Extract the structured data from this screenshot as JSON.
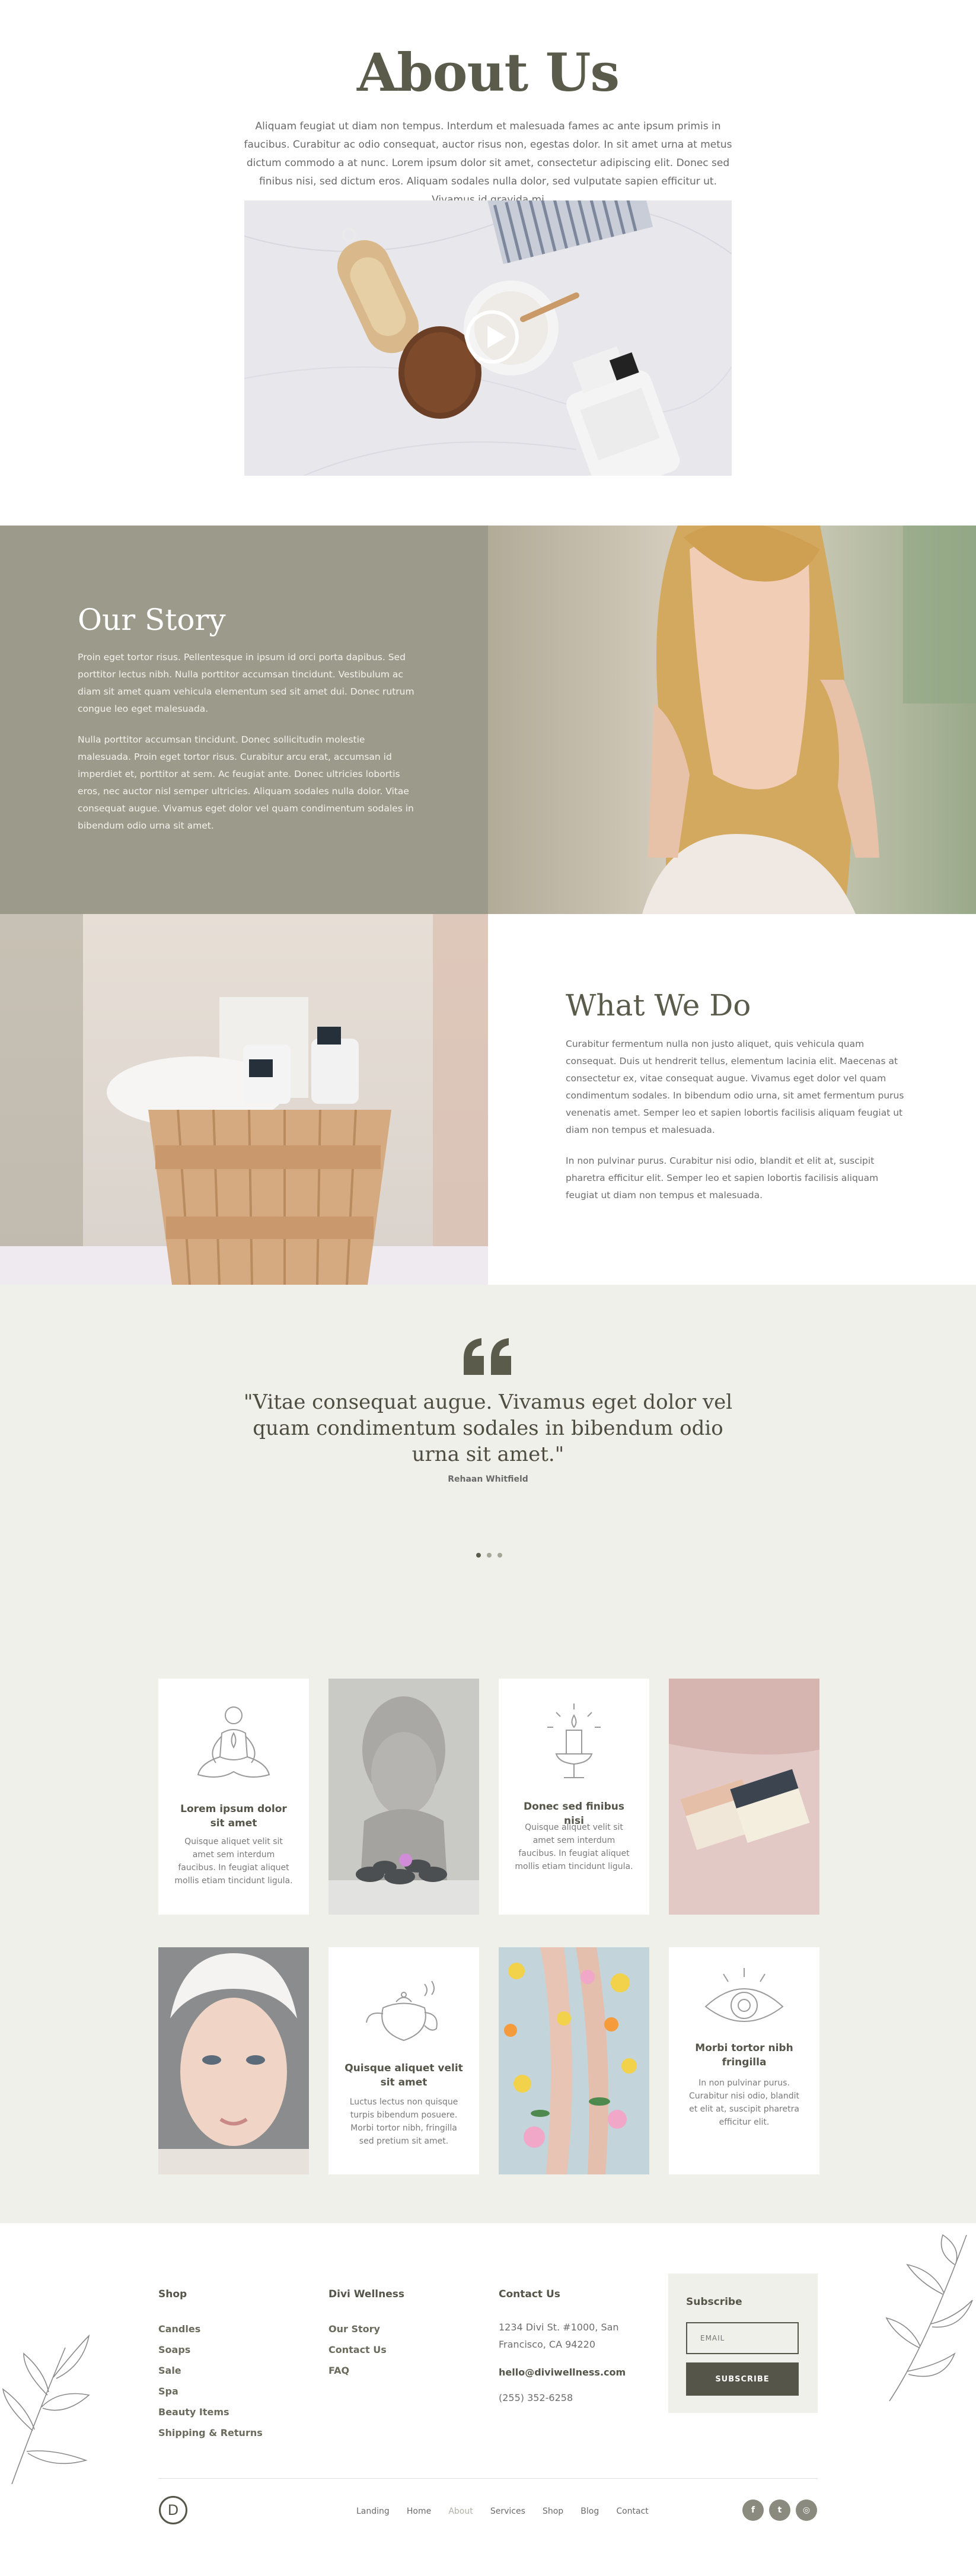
{
  "hero": {
    "title": "About Us",
    "intro": "Aliquam feugiat ut diam non tempus. Interdum et malesuada fames ac ante ipsum primis in faucibus. Curabitur ac odio consequat, auctor risus non, egestas dolor. In sit amet urna at metus dictum commodo a at nunc. Lorem ipsum dolor sit amet, consectetur adipiscing elit. Donec sed finibus nisi, sed dictum eros. Aliquam sodales nulla dolor, sed vulputate sapien efficitur ut. Vivamus id gravida mi",
    "video_icon": "play-icon"
  },
  "story": {
    "title": "Our Story",
    "p1": "Proin eget tortor risus. Pellentesque in ipsum id orci porta dapibus. Sed porttitor lectus nibh. Nulla porttitor accumsan tincidunt. Vestibulum ac diam sit amet quam vehicula elementum sed sit amet dui. Donec rutrum congue leo eget malesuada.",
    "p2": "Nulla porttitor accumsan tincidunt. Donec sollicitudin molestie malesuada. Proin eget tortor risus. Curabitur arcu erat, accumsan id imperdiet et, porttitor at sem. Ac feugiat ante. Donec ultricies lobortis eros, nec auctor nisl semper ultricies. Aliquam sodales nulla dolor. Vitae consequat augue. Vivamus eget dolor vel quam condimentum sodales in bibendum odio urna sit amet."
  },
  "what_we_do": {
    "title": "What We Do",
    "p1": "Curabitur fermentum nulla non justo aliquet, quis vehicula quam consequat. Duis ut hendrerit tellus, elementum lacinia elit. Maecenas at consectetur ex, vitae consequat augue. Vivamus eget dolor vel quam condimentum sodales. In bibendum odio urna, sit amet fermentum purus venenatis amet. Semper leo et sapien lobortis facilisis aliquam feugiat ut diam non tempus et malesuada.",
    "p2": "In non pulvinar purus. Curabitur nisi odio, blandit et elit at, suscipit pharetra efficitur elit. Semper leo et sapien lobortis facilisis aliquam feugiat ut diam non tempus et malesuada."
  },
  "testimonial": {
    "quote": "\"Vitae consequat augue. Vivamus eget dolor vel quam condimentum sodales in bibendum odio urna sit amet.\"",
    "author": "Rehaan Whitfield",
    "slides": 3,
    "active_slide": 1
  },
  "cards": [
    {
      "type": "icon",
      "icon": "meditation-icon",
      "title": "Lorem ipsum dolor sit amet",
      "desc": "Quisque aliquet velit sit amet sem interdum faucibus. In feugiat aliquet mollis etiam tincidunt ligula."
    },
    {
      "type": "photo",
      "icon": "buddha-statue-image"
    },
    {
      "type": "icon",
      "icon": "candle-icon",
      "title": "Donec sed finibus nisi",
      "desc": "Quisque aliquet velit sit amet sem interdum faucibus. In feugiat aliquet mollis etiam tincidunt ligula."
    },
    {
      "type": "photo",
      "icon": "soap-bars-image"
    },
    {
      "type": "photo",
      "icon": "towel-portrait-image"
    },
    {
      "type": "icon",
      "icon": "teapot-icon",
      "title": "Quisque aliquet velit sit amet",
      "desc": "Luctus lectus non quisque turpis bibendum posuere. Morbi tortor nibh, fringilla sed pretium sit amet."
    },
    {
      "type": "photo",
      "icon": "flower-bath-image"
    },
    {
      "type": "icon",
      "icon": "eye-icon",
      "title": "Morbi tortor nibh fringilla",
      "desc": "In non pulvinar purus. Curabitur nisi odio, blandit et elit at, suscipit pharetra efficitur elit."
    }
  ],
  "footer": {
    "shop": {
      "heading": "Shop",
      "links": [
        "Candles",
        "Soaps",
        "Sale",
        "Spa",
        "Beauty Items",
        "Shipping & Returns"
      ]
    },
    "brand": {
      "heading": "Divi Wellness",
      "links": [
        "Our Story",
        "Contact Us",
        "FAQ"
      ]
    },
    "contact": {
      "heading": "Contact Us",
      "address": "1234 Divi St. #1000, San Francisco, CA 94220",
      "email": "hello@diviwellness.com",
      "phone": "(255) 352-6258"
    },
    "subscribe": {
      "heading": "Subscribe",
      "placeholder": "EMAIL",
      "button": "SUBSCRIBE"
    },
    "logo": "D",
    "nav": [
      "Landing",
      "Home",
      "About",
      "Services",
      "Shop",
      "Blog",
      "Contact"
    ],
    "nav_current": "About",
    "social": [
      {
        "icon": "facebook-icon",
        "glyph": "f"
      },
      {
        "icon": "twitter-icon",
        "glyph": "t"
      },
      {
        "icon": "instagram-icon",
        "glyph": "◎"
      }
    ]
  },
  "colors": {
    "olive_dark": "#5b5b4b",
    "olive_mid": "#9c9a8a",
    "beige": "#f0f0eb",
    "button": "#55554a"
  }
}
